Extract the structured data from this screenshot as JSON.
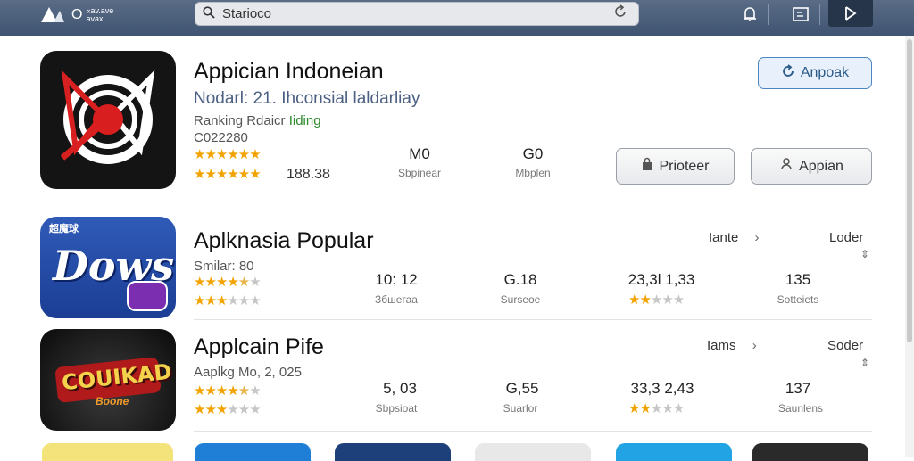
{
  "topbar": {
    "logo_mark": "▲",
    "logo_letter": "O",
    "logo_small_1": "«av.ave",
    "logo_small_2": "avax",
    "search_value": "Starioco",
    "search_icon": "search-icon",
    "refresh_icon": "refresh-icon",
    "notification_icon": "bell-icon",
    "window_icon": "window-icon",
    "dark_icon": "play-icon"
  },
  "featured": {
    "name": "Appician Indoneian",
    "line1": "Nodarl: 21. Ihconsial laldarliay",
    "line2_prefix": "Ranking Rdaicr ",
    "line2_highlight": "Iiding",
    "line3": "C022280",
    "rating_count": "188.38",
    "stat1_value": "M0",
    "stat1_label": "Sbpinear",
    "stat2_value": "G0",
    "stat2_label": "Mbplen",
    "primary_button": "Anpoak",
    "button2": "Prioteer",
    "button3": "Appian",
    "colors": {
      "accent": "#4d85c1",
      "highlight_text": "#2e8a2e"
    }
  },
  "list": [
    {
      "name": "Aplknasia Popular",
      "sub": "Smilar: 80",
      "icon_text": "Dows",
      "icon_badge": "超魔球",
      "stat1_value": "10: 12",
      "stat1_label": "Збшегаа",
      "stat2_value": "G.18",
      "stat2_label": "Surseoe",
      "stat3_value": "23,3l 1,33",
      "stat4_value": "135",
      "stat4_label": "Sotteiets",
      "link_label": "Iante",
      "right_label": "Loder"
    },
    {
      "name": "Applcain Pife",
      "sub": "Aaplkg Mo, 2, 025",
      "icon_text": "COUIKAD",
      "icon_sub": "Boone",
      "stat1_value": "5, 03",
      "stat1_label": "Sbpsioat",
      "stat2_value": "G,55",
      "stat2_label": "Suarlor",
      "stat3_value": "33,3 2,43",
      "stat4_value": "137",
      "stat4_label": "Saunlens",
      "link_label": "Iams",
      "right_label": "Soder"
    }
  ]
}
